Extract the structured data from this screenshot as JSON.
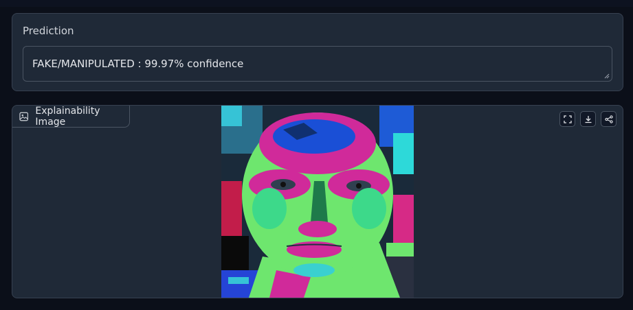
{
  "prediction": {
    "label": "Prediction",
    "value": "FAKE/MANIPULATED : 99.97% confidence"
  },
  "explainability": {
    "label": "Explainability Image",
    "image_icon": "image-icon",
    "toolbar": [
      "fullscreen-icon",
      "download-icon",
      "share-icon"
    ]
  },
  "colors": {
    "panel_bg": "#1f2937",
    "page_bg": "#0b0f19",
    "border": "#374151",
    "text": "#e5e7eb"
  }
}
